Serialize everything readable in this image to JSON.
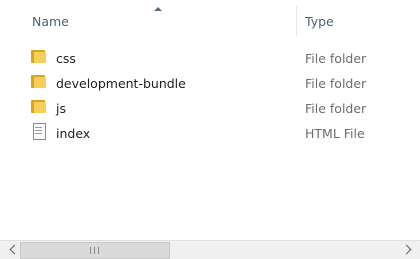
{
  "header": {
    "name_label": "Name",
    "type_label": "Type",
    "sort_icon": "sort-ascending-icon"
  },
  "rows": [
    {
      "name": "css",
      "type": "File folder",
      "icon": "folder-icon"
    },
    {
      "name": "development-bundle",
      "type": "File folder",
      "icon": "folder-icon"
    },
    {
      "name": "js",
      "type": "File folder",
      "icon": "folder-icon"
    },
    {
      "name": "index",
      "type": "HTML File",
      "icon": "file-icon"
    }
  ],
  "scrollbar": {
    "left_icon": "chevron-left-icon",
    "right_icon": "chevron-right-icon"
  },
  "colors": {
    "header_text": "#4c607a",
    "folder": "#f5cf58",
    "folder_back": "#d8a520",
    "type_text": "#6d6d6d"
  }
}
